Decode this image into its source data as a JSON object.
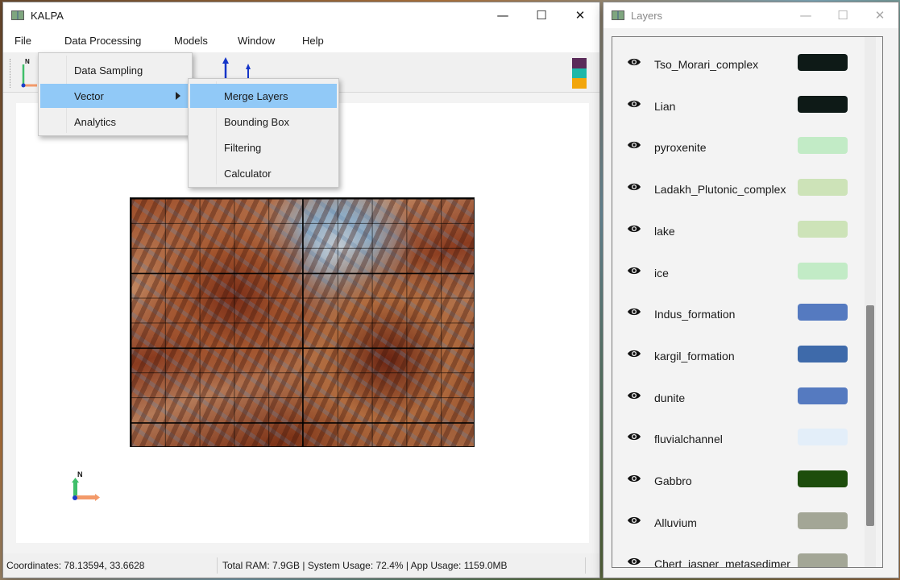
{
  "main_window": {
    "title": "KALPA",
    "controls": {
      "minimize": "—",
      "maximize": "☐",
      "close": "✕"
    }
  },
  "menubar": {
    "file": "File",
    "data_processing": "Data Processing",
    "models": "Models",
    "window": "Window",
    "help": "Help"
  },
  "data_processing_menu": {
    "items": [
      "Data Sampling",
      "Vector",
      "Analytics"
    ],
    "highlighted": "Vector"
  },
  "vector_submenu": {
    "items": [
      "Merge Layers",
      "Bounding Box",
      "Filtering",
      "Calculator"
    ],
    "highlighted": "Merge Layers"
  },
  "toolbar": {
    "north_label": "N",
    "colors": [
      "#5b2c5a",
      "#1fb8a8",
      "#f2a60c"
    ]
  },
  "canvas": {
    "north_label": "N"
  },
  "statusbar": {
    "coordinates": "Coordinates: 78.13594, 33.6628",
    "usage": "Total RAM: 7.9GB | System Usage: 72.4% | App Usage: 1159.0MB"
  },
  "layers_window": {
    "title": "Layers",
    "controls": {
      "minimize": "—",
      "maximize": "☐",
      "close": "✕"
    },
    "layers": [
      {
        "name": "Tso_Morari_complex",
        "color": "#0e1a17"
      },
      {
        "name": "Lian",
        "color": "#0e1a17"
      },
      {
        "name": "pyroxenite",
        "color": "#c2ebc6"
      },
      {
        "name": "Ladakh_Plutonic_complex",
        "color": "#cde3b8"
      },
      {
        "name": "lake",
        "color": "#cde3b8"
      },
      {
        "name": "ice",
        "color": "#c2ebc6"
      },
      {
        "name": "Indus_formation",
        "color": "#557ac0"
      },
      {
        "name": "kargil_formation",
        "color": "#3e6aaa"
      },
      {
        "name": "dunite",
        "color": "#557ac0"
      },
      {
        "name": "fluvialchannel",
        "color": "#e3eef9"
      },
      {
        "name": "Gabbro",
        "color": "#1d4d0c"
      },
      {
        "name": "Alluvium",
        "color": "#a3a696"
      },
      {
        "name": "Chert_jasper_metasedimer",
        "color": "#a3a696"
      }
    ]
  }
}
